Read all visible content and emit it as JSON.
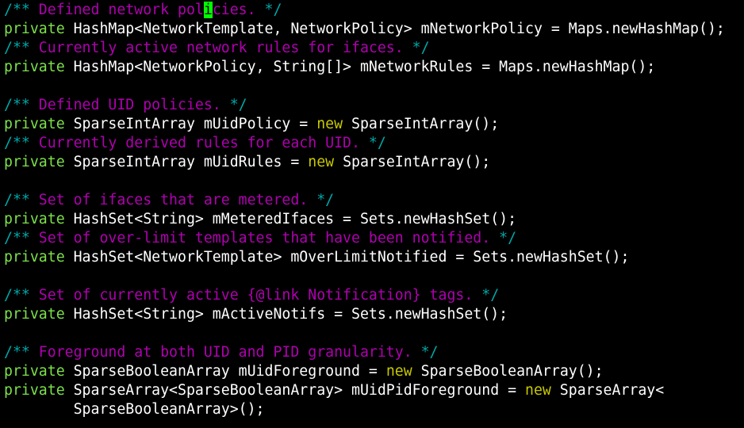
{
  "colors": {
    "background": "#000000",
    "comment_delimiter": "#00a8a8",
    "comment_text": "#b000b0",
    "keyword_private": "#7ce04a",
    "keyword_new": "#c8c800",
    "plain_text": "#ffffff",
    "cursor": "#00ff00"
  },
  "code": {
    "l1": {
      "open": "/**",
      "text_a": " Defined network pol",
      "cursor_char": "i",
      "text_b": "cies.",
      "close": " */"
    },
    "l2": {
      "kw": "private",
      "rest": " HashMap<NetworkTemplate, NetworkPolicy> mNetworkPolicy = Maps.newHashMap();"
    },
    "l3": {
      "open": "/**",
      "text": " Currently active network rules for ifaces.",
      "close": " */"
    },
    "l4": {
      "kw": "private",
      "rest": " HashMap<NetworkPolicy, String[]> mNetworkRules = Maps.newHashMap();"
    },
    "l6": {
      "open": "/**",
      "text": " Defined UID policies.",
      "close": " */"
    },
    "l7": {
      "kw": "private",
      "pre": " SparseIntArray mUidPolicy = ",
      "new": "new",
      "post": " SparseIntArray();"
    },
    "l8": {
      "open": "/**",
      "text": " Currently derived rules for each UID.",
      "close": " */"
    },
    "l9": {
      "kw": "private",
      "pre": " SparseIntArray mUidRules = ",
      "new": "new",
      "post": " SparseIntArray();"
    },
    "l11": {
      "open": "/**",
      "text": " Set of ifaces that are metered.",
      "close": " */"
    },
    "l12": {
      "kw": "private",
      "rest": " HashSet<String> mMeteredIfaces = Sets.newHashSet();"
    },
    "l13": {
      "open": "/**",
      "text": " Set of over-limit templates that have been notified.",
      "close": " */"
    },
    "l14": {
      "kw": "private",
      "rest": " HashSet<NetworkTemplate> mOverLimitNotified = Sets.newHashSet();"
    },
    "l16": {
      "open": "/**",
      "text": " Set of currently active {@link Notification} tags.",
      "close": " */"
    },
    "l17": {
      "kw": "private",
      "rest": " HashSet<String> mActiveNotifs = Sets.newHashSet();"
    },
    "l19": {
      "open": "/**",
      "text": " Foreground at both UID and PID granularity.",
      "close": " */"
    },
    "l20": {
      "kw": "private",
      "pre": " SparseBooleanArray mUidForeground = ",
      "new": "new",
      "post": " SparseBooleanArray();"
    },
    "l21": {
      "kw": "private",
      "pre": " SparseArray<SparseBooleanArray> mUidPidForeground = ",
      "new": "new",
      "post": " SparseArray<"
    },
    "l22": {
      "rest": "        SparseBooleanArray>();"
    }
  }
}
